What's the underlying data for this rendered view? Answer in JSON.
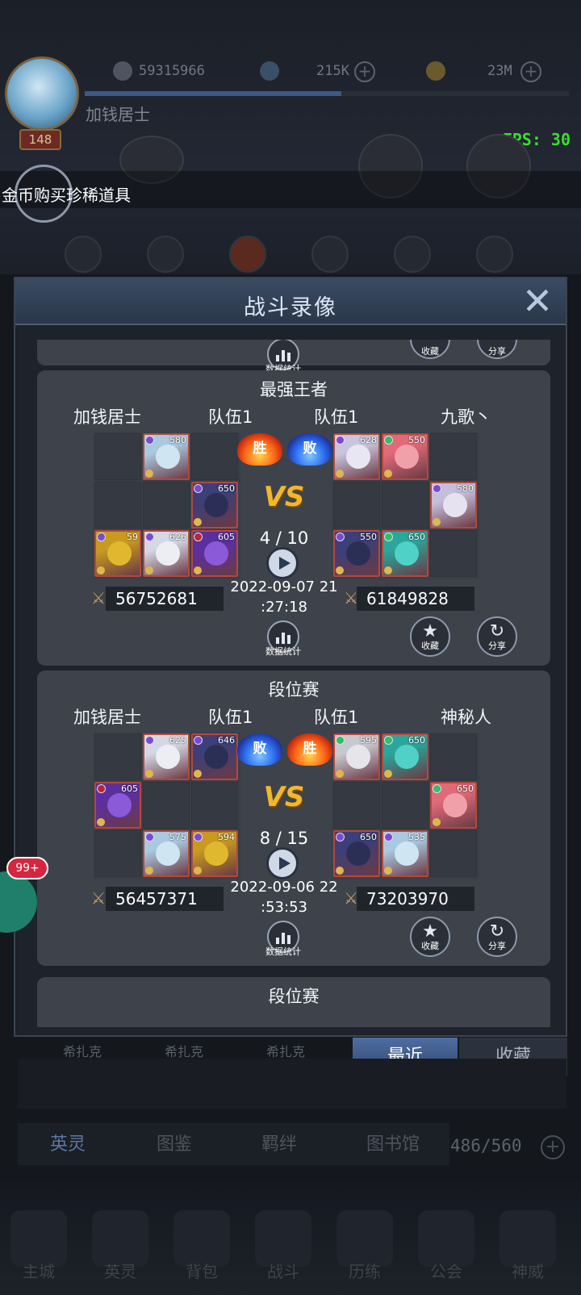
{
  "top_bar": {
    "power": "59315966",
    "gems": "215K",
    "gold": "23M",
    "player_name": "加钱居士",
    "level": "148",
    "xp_fraction": 0.53,
    "fps": "FPS: 30"
  },
  "banner": {
    "text": "金币购买珍稀道具"
  },
  "modal": {
    "title": "战斗录像",
    "close_icon": "close-icon"
  },
  "battles": [
    {
      "mode": "最强王者",
      "left": {
        "player": "加钱居士",
        "team": "队伍1",
        "result": "胜",
        "power": "56752681",
        "heroes": [
          {
            "row": 0,
            "col": 1,
            "level": "580",
            "elem": "#7a4ad6",
            "face": "#cfe6f2",
            "hair": "#a9c9e0"
          },
          {
            "row": 1,
            "col": 2,
            "level": "650",
            "elem": "#7a4ad6",
            "face": "#2c2f55",
            "hair": "#3c3f78"
          },
          {
            "row": 2,
            "col": 0,
            "level": "59",
            "elem": "#7a4ad6",
            "face": "#e0b830",
            "hair": "#c99a20"
          },
          {
            "row": 2,
            "col": 1,
            "level": "626",
            "elem": "#7a4ad6",
            "face": "#eceef4",
            "hair": "#d4d8e6"
          },
          {
            "row": 2,
            "col": 2,
            "level": "605",
            "elem": "#b8263c",
            "face": "#8a5ad8",
            "hair": "#5b2fa0"
          }
        ]
      },
      "right": {
        "player": "九歌丶",
        "team": "队伍1",
        "result": "败",
        "power": "61849828",
        "heroes": [
          {
            "row": 0,
            "col": 0,
            "level": "628",
            "elem": "#7a4ad6",
            "face": "#e8e6f2",
            "hair": "#c9c5de"
          },
          {
            "row": 0,
            "col": 1,
            "level": "550",
            "elem": "#2fbf6a",
            "face": "#f0a0a8",
            "hair": "#e06a78"
          },
          {
            "row": 1,
            "col": 2,
            "level": "580",
            "elem": "#7a4ad6",
            "face": "#e6e2f0",
            "hair": "#c5bedb"
          },
          {
            "row": 2,
            "col": 0,
            "level": "550",
            "elem": "#7a4ad6",
            "face": "#2c2f55",
            "hair": "#3c3f78"
          },
          {
            "row": 2,
            "col": 1,
            "level": "650",
            "elem": "#2fbf6a",
            "face": "#4fd1c8",
            "hair": "#2aa69c"
          }
        ]
      },
      "rounds": "4 / 10",
      "date_line1": "2022-09-07 21",
      "date_line2": ":27:18",
      "stats_label": "数据统计",
      "fav_label": "收藏",
      "share_label": "分享"
    },
    {
      "mode": "段位赛",
      "left": {
        "player": "加钱居士",
        "team": "队伍1",
        "result": "败",
        "power": "56457371",
        "heroes": [
          {
            "row": 0,
            "col": 1,
            "level": "625",
            "elem": "#7a4ad6",
            "face": "#eceef4",
            "hair": "#d4d8e6"
          },
          {
            "row": 0,
            "col": 2,
            "level": "646",
            "elem": "#7a4ad6",
            "face": "#2c2f55",
            "hair": "#3c3f78"
          },
          {
            "row": 1,
            "col": 0,
            "level": "605",
            "elem": "#b8263c",
            "face": "#8a5ad8",
            "hair": "#5b2fa0"
          },
          {
            "row": 2,
            "col": 1,
            "level": "575",
            "elem": "#7a4ad6",
            "face": "#cfe6f2",
            "hair": "#a9c9e0"
          },
          {
            "row": 2,
            "col": 2,
            "level": "594",
            "elem": "#7a4ad6",
            "face": "#e0b830",
            "hair": "#c99a20"
          }
        ]
      },
      "right": {
        "player": "神秘人",
        "team": "队伍1",
        "result": "胜",
        "power": "73203970",
        "heroes": [
          {
            "row": 0,
            "col": 0,
            "level": "595",
            "elem": "#2fbf6a",
            "face": "#e6e6ea",
            "hair": "#c8c8d0"
          },
          {
            "row": 0,
            "col": 1,
            "level": "650",
            "elem": "#2fbf6a",
            "face": "#4fd1c8",
            "hair": "#2aa69c"
          },
          {
            "row": 1,
            "col": 2,
            "level": "650",
            "elem": "#2fbf6a",
            "face": "#f0a0a8",
            "hair": "#e06a78"
          },
          {
            "row": 2,
            "col": 0,
            "level": "650",
            "elem": "#7a4ad6",
            "face": "#2c2f55",
            "hair": "#3c3f78"
          },
          {
            "row": 2,
            "col": 1,
            "level": "535",
            "elem": "#7a4ad6",
            "face": "#cfe6f2",
            "hair": "#a9c9e0"
          }
        ]
      },
      "rounds": "8 / 15",
      "date_line1": "2022-09-06 22",
      "date_line2": ":53:53",
      "stats_label": "数据统计",
      "fav_label": "收藏",
      "share_label": "分享"
    }
  ],
  "partial_top": {
    "stats_label": "数据统计",
    "fav_label": "收藏",
    "share_label": "分享"
  },
  "partial_bottom": {
    "mode": "段位赛"
  },
  "tabs": {
    "recent": "最近",
    "favorites": "收藏"
  },
  "background": {
    "hero_labels": [
      "希扎克",
      "希扎克",
      "希扎克"
    ],
    "sub_tabs": [
      "英灵",
      "图鉴",
      "羁绊",
      "图书馆"
    ],
    "count": "486/560",
    "notif": "99+",
    "nav": [
      "主城",
      "英灵",
      "背包",
      "战斗",
      "历练",
      "公会",
      "神威"
    ]
  },
  "colors": {
    "win": "#ff6a1a",
    "lose": "#2f6ff0",
    "accent": "#4f6da1",
    "fps": "#37e02b"
  }
}
